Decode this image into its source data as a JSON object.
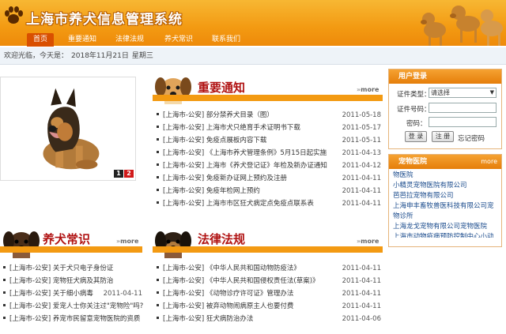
{
  "header": {
    "site_title": "上海市养犬信息管理系统"
  },
  "nav": {
    "items": [
      {
        "label": "首页",
        "active": true
      },
      {
        "label": "重要通知",
        "active": false
      },
      {
        "label": "法律法规",
        "active": false
      },
      {
        "label": "养犬常识",
        "active": false
      },
      {
        "label": "联系我们",
        "active": false
      }
    ]
  },
  "welcome": {
    "greeting": "欢迎光临，今天是：",
    "date": "2018年11月21日",
    "weekday": "星期三"
  },
  "slideshow": {
    "pages": [
      "1",
      "2"
    ]
  },
  "notices": {
    "title": "重要通知",
    "more": "more",
    "items": [
      {
        "text": "[上海市-公安] 部分禁养犬目录（图）",
        "date": "2011-05-18"
      },
      {
        "text": "[上海市-公安] 上海市犬只绝育手术证明书下载",
        "date": "2011-05-17"
      },
      {
        "text": "[上海市-公安] 免疫点展板内容下载",
        "date": "2011-05-11"
      },
      {
        "text": "[上海市-公安] 《上海市养犬管理条例》5月15日起实施",
        "date": "2011-04-13"
      },
      {
        "text": "[上海市-公安] 上海市《养犬登记证》年检及新办证通知",
        "date": "2011-04-12"
      },
      {
        "text": "[上海市-公安] 免疫新办证网上预约及注册",
        "date": "2011-04-11"
      },
      {
        "text": "[上海市-公安] 免疫年检网上预约",
        "date": "2011-04-11"
      },
      {
        "text": "[上海市-公安] 上海市市区狂犬病定点免疫点联系表",
        "date": "2011-04-11"
      }
    ]
  },
  "knowledge": {
    "title": "养犬常识",
    "more": "more",
    "items": [
      {
        "text": "[上海市-公安] 关于犬只电子身份证",
        "date": ""
      },
      {
        "text": "[上海市-公安] 宠物狂犬病及其防治",
        "date": ""
      },
      {
        "text": "[上海市-公安] 关于细小病毒",
        "date": "2011-04-11"
      },
      {
        "text": "[上海市-公安] 爱宠人士你关注过\"宠物险\"吗?",
        "date": ""
      },
      {
        "text": "[上海市-公安] 养宠市民留意宠物医院的资质",
        "date": ""
      }
    ]
  },
  "laws": {
    "title": "法律法规",
    "more": "more",
    "items": [
      {
        "text": "[上海市-公安] 《中华人民共和国动物防疫法》",
        "date": "2011-04-11"
      },
      {
        "text": "[上海市-公安] 《中华人民共和国侵权责任法(草案)》",
        "date": "2011-04-11"
      },
      {
        "text": "[上海市-公安] 《动物诊疗许可证》管理办法",
        "date": "2011-04-11"
      },
      {
        "text": "[上海市-公安] 被弃动物闹病原主人也要付费",
        "date": "2011-04-11"
      },
      {
        "text": "[上海市-公安] 狂犬病防治办法",
        "date": "2011-04-06"
      }
    ]
  },
  "login": {
    "title": "用户登录",
    "cert_type_label": "证件类型：",
    "cert_type_value": "请选择",
    "cert_no_label": "证件号码：",
    "password_label": "密码：",
    "login_button": "登 录",
    "register_button": "注 册",
    "forgot_link": "忘记密码"
  },
  "hospitals": {
    "title": "宠物医院",
    "more": "more",
    "items": [
      "物医院",
      "小精灵宠物医院有限公司",
      "芭芭拉宠物有限公司",
      "上海申丰畜牧兽医科技有限公司宠物诊所",
      "上海龙戈宠物有限公司宠物医院",
      "上海市动物疫病预防控制中心小动物"
    ]
  },
  "colors": {
    "header_orange": "#f39a12",
    "title_red": "#b01212",
    "link_blue": "#1a4b8c"
  }
}
